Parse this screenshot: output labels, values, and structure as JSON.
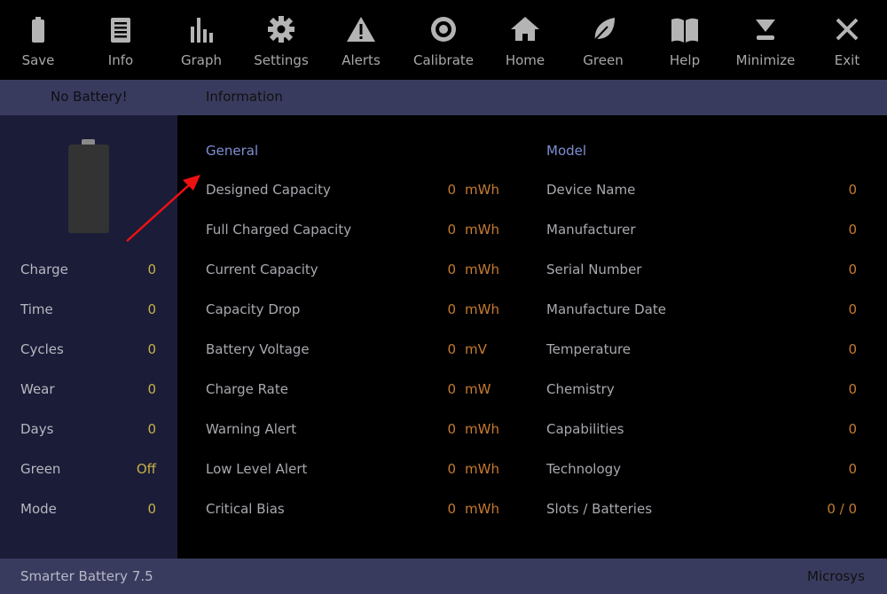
{
  "toolbar": {
    "items": [
      {
        "label": "Save",
        "icon": "battery-icon"
      },
      {
        "label": "Info",
        "icon": "document-icon"
      },
      {
        "label": "Graph",
        "icon": "bar-chart-icon"
      },
      {
        "label": "Settings",
        "icon": "gear-icon"
      },
      {
        "label": "Alerts",
        "icon": "warning-icon"
      },
      {
        "label": "Calibrate",
        "icon": "target-icon"
      },
      {
        "label": "Home",
        "icon": "home-icon"
      },
      {
        "label": "Green",
        "icon": "leaf-icon"
      },
      {
        "label": "Help",
        "icon": "book-icon"
      },
      {
        "label": "Minimize",
        "icon": "minimize-icon"
      },
      {
        "label": "Exit",
        "icon": "close-icon"
      }
    ]
  },
  "subbar": {
    "status": "No Battery!",
    "section": "Information"
  },
  "sidebar": {
    "items": [
      {
        "label": "Charge",
        "value": "0"
      },
      {
        "label": "Time",
        "value": "0"
      },
      {
        "label": "Cycles",
        "value": "0"
      },
      {
        "label": "Wear",
        "value": "0"
      },
      {
        "label": "Days",
        "value": "0"
      },
      {
        "label": "Green",
        "value": "Off"
      },
      {
        "label": "Mode",
        "value": "0"
      }
    ]
  },
  "general": {
    "title": "General",
    "rows": [
      {
        "label": "Designed Capacity",
        "value": "0",
        "unit": "mWh"
      },
      {
        "label": "Full Charged Capacity",
        "value": "0",
        "unit": "mWh"
      },
      {
        "label": "Current Capacity",
        "value": "0",
        "unit": "mWh"
      },
      {
        "label": "Capacity Drop",
        "value": "0",
        "unit": "mWh"
      },
      {
        "label": "Battery Voltage",
        "value": "0",
        "unit": "mV"
      },
      {
        "label": "Charge Rate",
        "value": "0",
        "unit": "mW"
      },
      {
        "label": "Warning Alert",
        "value": "0",
        "unit": "mWh"
      },
      {
        "label": "Low Level Alert",
        "value": "0",
        "unit": "mWh"
      },
      {
        "label": "Critical Bias",
        "value": "0",
        "unit": "mWh"
      }
    ]
  },
  "model": {
    "title": "Model",
    "rows": [
      {
        "label": "Device Name",
        "value": "0"
      },
      {
        "label": "Manufacturer",
        "value": "0"
      },
      {
        "label": "Serial Number",
        "value": "0"
      },
      {
        "label": "Manufacture Date",
        "value": "0"
      },
      {
        "label": "Temperature",
        "value": "0"
      },
      {
        "label": "Chemistry",
        "value": "0"
      },
      {
        "label": "Capabilities",
        "value": "0"
      },
      {
        "label": "Technology",
        "value": "0"
      },
      {
        "label": "Slots / Batteries",
        "value": "0 / 0"
      }
    ]
  },
  "footer": {
    "app": "Smarter Battery 7.5",
    "vendor": "Microsys"
  },
  "colors": {
    "toolbar_bg": "#000000",
    "bar_bg": "#393b5e",
    "sidebar_bg": "#1a1c38",
    "section_title": "#7e8fd2",
    "value": "#c67a30",
    "sidebar_value": "#c8b048",
    "annotation_arrow": "#ee1111"
  }
}
